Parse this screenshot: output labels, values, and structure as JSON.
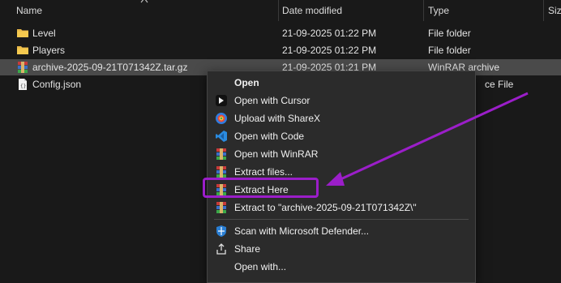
{
  "columns": {
    "name": "Name",
    "date": "Date modified",
    "type": "Type",
    "size": "Siz"
  },
  "files": [
    {
      "name": "Level",
      "date": "21-09-2025 01:22 PM",
      "type": "File folder",
      "icon": "folder-icon"
    },
    {
      "name": "Players",
      "date": "21-09-2025 01:22 PM",
      "type": "File folder",
      "icon": "folder-icon"
    },
    {
      "name": "archive-2025-09-21T071342Z.tar.gz",
      "date": "21-09-2025 01:21 PM",
      "type": "WinRAR archive",
      "icon": "winrar-icon"
    },
    {
      "name": "Config.json",
      "date": "",
      "type": "ce File",
      "icon": "json-file-icon"
    }
  ],
  "menu": {
    "open": "Open",
    "open_cursor": "Open with Cursor",
    "upload_sharex": "Upload with ShareX",
    "open_code": "Open with Code",
    "open_winrar": "Open with WinRAR",
    "extract_files": "Extract files...",
    "extract_here": "Extract Here",
    "extract_to": "Extract to \"archive-2025-09-21T071342Z\\\"",
    "scan_defender": "Scan with Microsoft Defender...",
    "share": "Share",
    "open_with": "Open with..."
  },
  "colors": {
    "background": "#191919",
    "menu_bg": "#2b2b2b",
    "highlight": "#9b1ec9",
    "folder": "#e8b84a"
  }
}
